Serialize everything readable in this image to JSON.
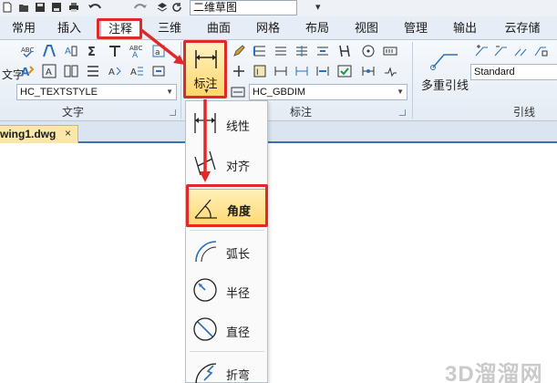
{
  "quick_access": {
    "workspace": "二维草图",
    "icons": [
      "new-icon",
      "open-icon",
      "save-icon",
      "saveas-icon",
      "print-icon",
      "undo-icon",
      "redo-icon",
      "layers-icon",
      "refresh-icon"
    ]
  },
  "tabs": [
    {
      "label": "常用"
    },
    {
      "label": "插入"
    },
    {
      "label": "注释",
      "active": true
    },
    {
      "label": "三维"
    },
    {
      "label": "曲面"
    },
    {
      "label": "网格"
    },
    {
      "label": "布局"
    },
    {
      "label": "视图"
    },
    {
      "label": "管理"
    },
    {
      "label": "输出"
    },
    {
      "label": "云存储"
    }
  ],
  "ribbon": {
    "text_group": {
      "label": "文字",
      "multiline_label": "文字",
      "style_value": "HC_TEXTSTYLE"
    },
    "dim_group": {
      "label": "标注",
      "big_button_label": "标注",
      "style_value": "HC_GBDIM"
    },
    "leader_group": {
      "label": "引线",
      "multileader_label": "多重引线",
      "style_value": "Standard"
    }
  },
  "document": {
    "tab_label": "wing1.dwg",
    "close_glyph": "×"
  },
  "dim_menu": {
    "items": [
      {
        "label": "线性",
        "icon": "linear-dim-icon"
      },
      {
        "label": "对齐",
        "icon": "aligned-dim-icon"
      },
      {
        "label": "角度",
        "icon": "angular-dim-icon",
        "highlighted": true
      },
      {
        "label": "弧长",
        "icon": "arc-length-icon"
      },
      {
        "label": "半径",
        "icon": "radius-dim-icon"
      },
      {
        "label": "直径",
        "icon": "diameter-dim-icon"
      },
      {
        "label": "折弯",
        "icon": "jogged-dim-icon"
      }
    ]
  },
  "colors": {
    "annotation_red": "#e02a2a",
    "highlight": "#ffd770",
    "icon_blue": "#2d6fb8"
  },
  "watermark": "3D溜溜网"
}
